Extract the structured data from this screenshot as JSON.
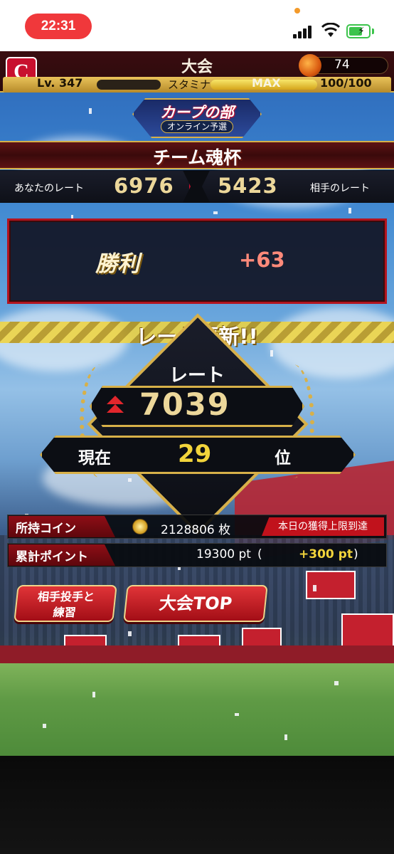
{
  "status_bar": {
    "time": "22:31",
    "battery_charging": true,
    "accent": "#f0383b"
  },
  "header": {
    "title": "大会",
    "logo_text": "C",
    "currency_value": "74",
    "level_label": "Lv. 347",
    "stamina_label": "スタミナ",
    "stamina_max_label": "MAX",
    "stamina_value": "100/100"
  },
  "tournament": {
    "emblem_title": "カープの部",
    "emblem_subtitle": "オンライン予選",
    "cup_name": "チーム魂杯"
  },
  "rates": {
    "my_label": "あなたのレート",
    "my_value": "6976",
    "opponent_value": "5423",
    "opponent_label": "相手のレート"
  },
  "result": {
    "label": "勝利",
    "delta": "+63"
  },
  "update": {
    "banner": "レート更新!!",
    "rate_caption": "レート",
    "rate_value": "7039",
    "rank_label": "現在",
    "rank_value": "29",
    "rank_suffix": "位"
  },
  "coins": {
    "label": "所持コイン",
    "value": "2128806 枚",
    "limit_badge": "本日の獲得上限到達"
  },
  "points": {
    "label": "累計ポイント",
    "value": "19300 pt",
    "paren_open": "(",
    "gain": "+300 pt",
    "paren_close": ")"
  },
  "buttons": {
    "practice_line1": "相手投手と",
    "practice_line2": "練習",
    "top": "大会TOP"
  },
  "colors": {
    "brand_red": "#c8102e",
    "gold": "#d7b049",
    "rate_text": "#ecd79a"
  }
}
